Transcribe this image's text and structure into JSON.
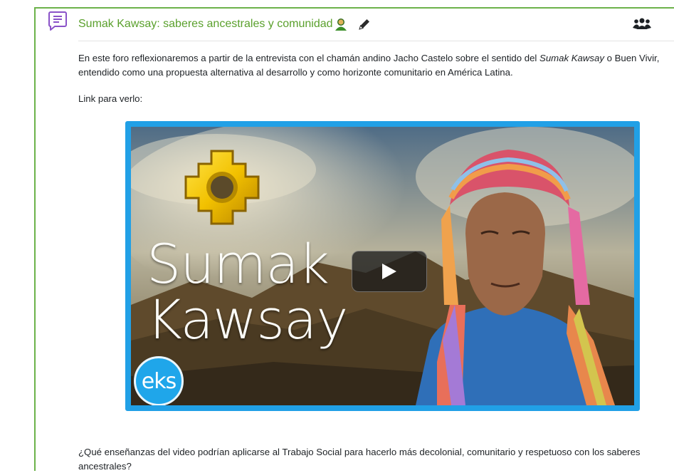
{
  "forum": {
    "title": "Sumak Kawsay: saberes ancestrales y comunidad",
    "icons": {
      "forum": "speech-bubble-lines-icon",
      "author": "person-green-icon",
      "edit": "pencil-icon",
      "groups": "group-people-icon"
    },
    "accent_color": "#5aa02c",
    "border_color": "#6cb24a"
  },
  "intro": {
    "before": "En este foro reflexionaremos a partir de la entrevista con el chamán andino Jacho Castelo sobre el sentido del ",
    "italic": "Sumak Kawsay",
    "after": " o Buen Vivir, entendido como una propuesta alternativa al desarrollo y como horizonte comunitario en América Latina."
  },
  "link_label": "Link para verlo:",
  "video": {
    "title_line1": "Sumak",
    "title_line2": "Kawsay",
    "logo_text": "eks",
    "border_color": "#21a0e6",
    "play_icon": "play-triangle-icon"
  },
  "question": "¿Qué enseñanzas del video podrían aplicarse al Trabajo Social para hacerlo más decolonial, comunitario y respetuoso con los saberes ancestrales?"
}
